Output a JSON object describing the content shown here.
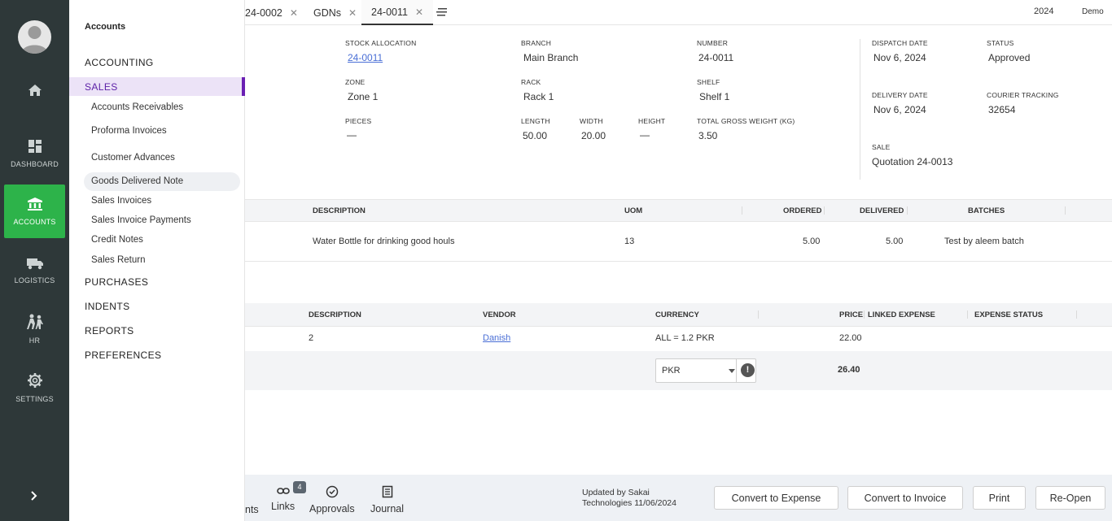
{
  "rail": {
    "items": [
      {
        "label": "",
        "icon": "home-icon"
      },
      {
        "label": "DASHBOARD",
        "icon": "dashboard-icon"
      },
      {
        "label": "ACCOUNTS",
        "icon": "bank-icon"
      },
      {
        "label": "LOGISTICS",
        "icon": "truck-icon"
      },
      {
        "label": "HR",
        "icon": "people-icon"
      },
      {
        "label": "SETTINGS",
        "icon": "gear-icon"
      }
    ],
    "accent": "#2db34a"
  },
  "drawer": {
    "title": "Accounts",
    "sections": {
      "accounting": "ACCOUNTING",
      "sales": "SALES",
      "purchases": "PURCHASES",
      "indents": "INDENTS",
      "reports": "REPORTS",
      "preferences": "PREFERENCES"
    },
    "sales_items": [
      "Accounts Receivables",
      "Proforma Invoices",
      "Customer Advances",
      "Goods Delivered Note",
      "Sales Invoices",
      "Sales Invoice Payments",
      "Credit Notes",
      "Sales Return"
    ],
    "active_color": "#6a1fb3"
  },
  "tabs": [
    {
      "label": "24-0002"
    },
    {
      "label": "GDNs"
    },
    {
      "label": "24-0011"
    }
  ],
  "header": {
    "year": "2024",
    "user": "Demo"
  },
  "details": {
    "stock_allocation": {
      "label": "STOCK ALLOCATION",
      "value": "24-0011"
    },
    "branch": {
      "label": "BRANCH",
      "value": "Main Branch"
    },
    "number": {
      "label": "NUMBER",
      "value": "24-0011"
    },
    "zone": {
      "label": "ZONE",
      "value": "Zone 1"
    },
    "rack": {
      "label": "RACK",
      "value": "Rack 1"
    },
    "shelf": {
      "label": "SHELF",
      "value": "Shelf 1"
    },
    "pieces": {
      "label": "PIECES",
      "value": "—"
    },
    "length": {
      "label": "LENGTH",
      "value": "50.00"
    },
    "width": {
      "label": "WIDTH",
      "value": "20.00"
    },
    "height": {
      "label": "HEIGHT",
      "value": "—"
    },
    "gross_weight": {
      "label": "TOTAL GROSS WEIGHT (KG)",
      "value": "3.50"
    },
    "dispatch_date": {
      "label": "DISPATCH DATE",
      "value": "Nov 6, 2024"
    },
    "status": {
      "label": "STATUS",
      "value": "Approved"
    },
    "delivery_date": {
      "label": "DELIVERY DATE",
      "value": "Nov 6, 2024"
    },
    "courier_tracking": {
      "label": "COURIER TRACKING",
      "value": "32654"
    },
    "sale": {
      "label": "SALE",
      "value": "Quotation 24-0013"
    }
  },
  "items_table": {
    "headers": {
      "description": "DESCRIPTION",
      "uom": "UOM",
      "ordered": "ORDERED",
      "delivered": "DELIVERED",
      "batches": "BATCHES"
    },
    "rows": [
      {
        "description": "Water Bottle for drinking good houls",
        "uom": "13",
        "ordered": "5.00",
        "delivered": "5.00",
        "batches": "Test by aleem batch"
      }
    ]
  },
  "expense_table": {
    "headers": {
      "description": "DESCRIPTION",
      "vendor": "VENDOR",
      "currency": "CURRENCY",
      "price": "PRICE",
      "linked_expense": "LINKED EXPENSE",
      "expense_status": "EXPENSE STATUS"
    },
    "rows": [
      {
        "description": "2",
        "vendor": "Danish",
        "currency": "ALL = 1.2 PKR",
        "price": "22.00"
      }
    ],
    "total": {
      "currency": "PKR",
      "amount": "26.40"
    }
  },
  "footer": {
    "comments_partial": "nts",
    "links": "Links",
    "links_count": "4",
    "approvals": "Approvals",
    "journal": "Journal",
    "updated_line1": "Updated by Sakai",
    "updated_line2": "Technologies 11/06/2024",
    "buttons": {
      "convert_expense": "Convert to Expense",
      "convert_invoice": "Convert to Invoice",
      "print": "Print",
      "reopen": "Re-Open"
    }
  }
}
